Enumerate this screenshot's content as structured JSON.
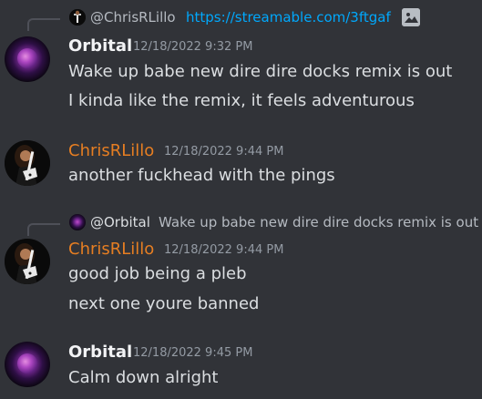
{
  "messages": [
    {
      "reply": {
        "name": "@ChrisRLillo",
        "link": "https://streamable.com/3ftgaf",
        "icon": "image-icon"
      },
      "author": "Orbital",
      "author_color": "#f2f3f5",
      "timestamp": "12/18/2022 9:32 PM",
      "lines": [
        "Wake up babe new dire dire docks remix is out",
        "I kinda like the remix, it feels adventurous"
      ]
    },
    {
      "author": "ChrisRLillo",
      "author_color": "#e67e22",
      "timestamp": "12/18/2022 9:44 PM",
      "lines": [
        "another fuckhead with the pings"
      ]
    },
    {
      "reply": {
        "name": "@Orbital",
        "text": "Wake up babe new dire dire docks remix is out"
      },
      "author": "ChrisRLillo",
      "author_color": "#e67e22",
      "timestamp": "12/18/2022 9:44 PM",
      "lines": [
        "good job being a pleb",
        "next one youre banned"
      ]
    },
    {
      "author": "Orbital",
      "author_color": "#f2f3f5",
      "timestamp": "12/18/2022 9:45 PM",
      "lines": [
        "Calm down alright"
      ]
    }
  ],
  "colors": {
    "background": "#313338",
    "text": "#dbdee1",
    "muted": "#949ba4",
    "link": "#00a8fc",
    "chris": "#e67e22"
  }
}
